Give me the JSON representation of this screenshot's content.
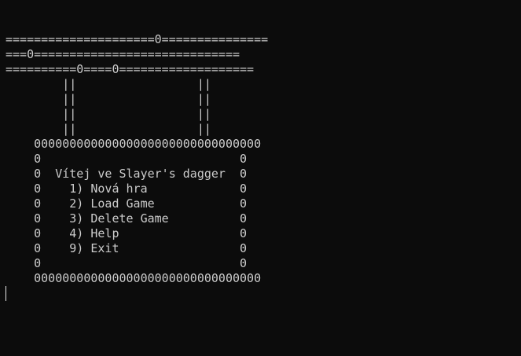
{
  "terminal": {
    "colors": {
      "background": "#0c0c0c",
      "foreground": "#cccccc",
      "cursor": "#e6e6e6"
    },
    "banner_lines": [
      "=====================0===============",
      "===0=============================",
      "==========0====0==================="
    ],
    "pillar_lines": [
      "        ||                 ||",
      "        ||                 ||",
      "        ||                 ||",
      "        ||                 ||"
    ],
    "box": {
      "top_border": "    00000000000000000000000000000000",
      "blank_top": "    0                            0",
      "title": "    0  Vítej ve Slayer's dagger  0",
      "menu_items": [
        "    0    1) Nová hra             0",
        "    0    2) Load Game            0",
        "    0    3) Delete Game          0",
        "    0    4) Help                 0",
        "    0    9) Exit                 0"
      ],
      "blank_bottom": "    0                            0",
      "bottom_border": "    00000000000000000000000000000000"
    },
    "input_line": ""
  }
}
